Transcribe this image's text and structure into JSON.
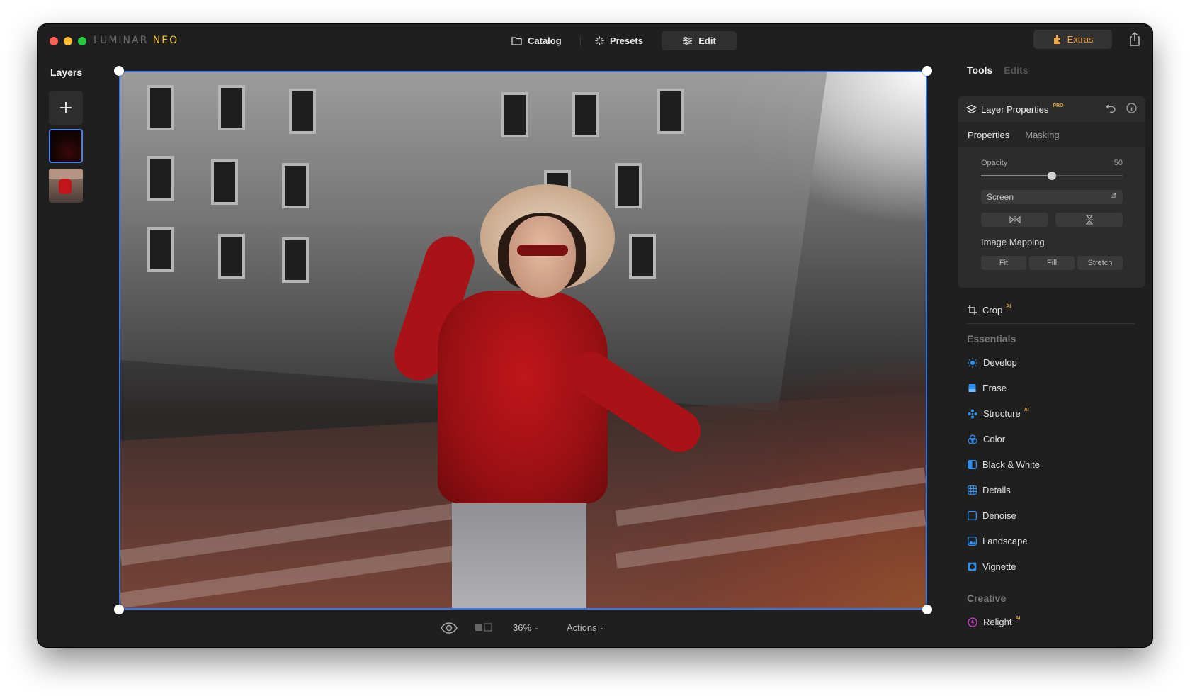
{
  "app": {
    "logo_part1": "LUMINAR",
    "logo_part2": "NEO"
  },
  "nav": {
    "catalog": "Catalog",
    "presets": "Presets",
    "edit": "Edit",
    "extras": "Extras"
  },
  "layers": {
    "title": "Layers"
  },
  "bottom": {
    "zoom": "36%",
    "actions": "Actions"
  },
  "panel": {
    "tabs": [
      "Tools",
      "Edits"
    ],
    "layer_properties": {
      "title": "Layer Properties",
      "badge": "PRO",
      "subtabs": [
        "Properties",
        "Masking"
      ],
      "opacity_label": "Opacity",
      "opacity_value": "50",
      "opacity_fraction": 0.5,
      "blend_mode": "Screen",
      "image_mapping_label": "Image Mapping",
      "mapping_options": [
        "Fit",
        "Fill",
        "Stretch"
      ]
    },
    "crop": {
      "label": "Crop",
      "badge": "AI"
    },
    "essentials": {
      "title": "Essentials",
      "items": [
        {
          "label": "Develop",
          "icon": "sun-icon",
          "badge": "",
          "color": "#2e8ff0"
        },
        {
          "label": "Erase",
          "icon": "eraser-icon",
          "badge": "",
          "color": "#2e8ff0"
        },
        {
          "label": "Structure",
          "icon": "structure-icon",
          "badge": "AI",
          "color": "#2e8ff0"
        },
        {
          "label": "Color",
          "icon": "color-circles-icon",
          "badge": "",
          "color": "#2e8ff0"
        },
        {
          "label": "Black & White",
          "icon": "half-square-icon",
          "badge": "",
          "color": "#2e8ff0"
        },
        {
          "label": "Details",
          "icon": "grid-icon",
          "badge": "",
          "color": "#2e8ff0"
        },
        {
          "label": "Denoise",
          "icon": "square-icon",
          "badge": "",
          "color": "#2e8ff0"
        },
        {
          "label": "Landscape",
          "icon": "landscape-icon",
          "badge": "",
          "color": "#2e8ff0"
        },
        {
          "label": "Vignette",
          "icon": "vignette-icon",
          "badge": "",
          "color": "#2e8ff0"
        }
      ]
    },
    "creative": {
      "title": "Creative",
      "items": [
        {
          "label": "Relight",
          "icon": "relight-icon",
          "badge": "AI",
          "color": "#d03fcf"
        }
      ]
    }
  },
  "colors": {
    "accent_blue": "#3b74e0",
    "extras_orange": "#f0a64b",
    "pro_gold": "#e0a43a"
  }
}
